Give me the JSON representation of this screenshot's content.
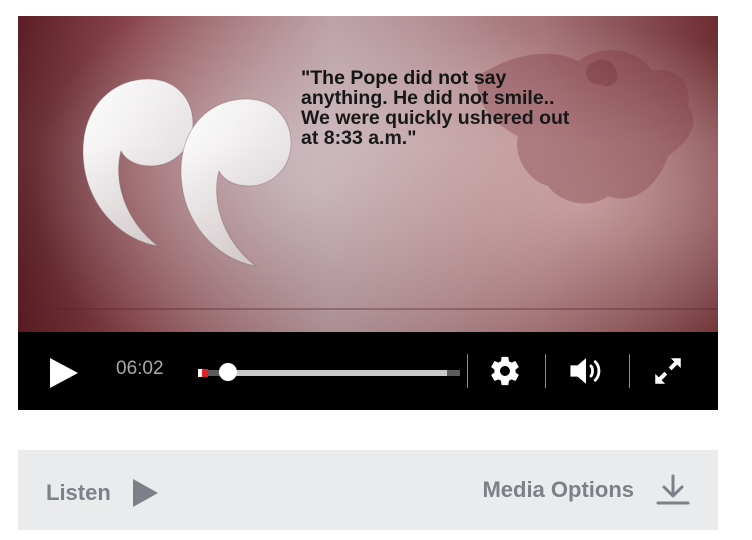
{
  "video": {
    "quote_text": "\"The Pope did not say\nanything. He did not smile..\nWe were quickly ushered out\nat 8:33 a.m.\""
  },
  "controls": {
    "current_time": "06:02",
    "progress_played_fraction": 0.1,
    "progress_buffered_fraction": 0.95,
    "icons": [
      "play-icon",
      "settings-gear-icon",
      "volume-icon",
      "fullscreen-icon"
    ]
  },
  "media_bar": {
    "listen_label": "Listen",
    "media_options_label": "Media Options",
    "icons": [
      "listen-play-icon",
      "download-icon"
    ]
  },
  "colors": {
    "progress_marker": "#e21f26",
    "controls_bg": "#000000",
    "media_bar_bg": "#eaebed",
    "media_text": "#7c8189"
  }
}
